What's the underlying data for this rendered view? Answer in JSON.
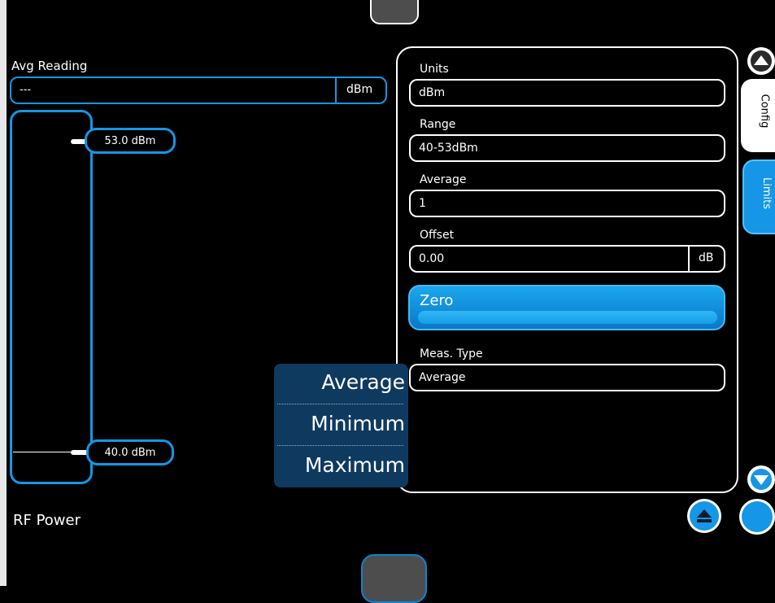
{
  "avg_reading": {
    "label": "Avg Reading",
    "value": "---",
    "unit": "dBm"
  },
  "gauge": {
    "upper_limit": "53.0 dBm",
    "lower_limit": "40.0 dBm"
  },
  "rf_label": "RF Power",
  "config": {
    "units": {
      "label": "Units",
      "value": "dBm"
    },
    "range": {
      "label": "Range",
      "value": "40-53dBm"
    },
    "average": {
      "label": "Average",
      "value": "1"
    },
    "offset": {
      "label": "Offset",
      "value": "0.00",
      "unit": "dB"
    },
    "zero_button": "Zero",
    "meas_type": {
      "label": "Meas. Type",
      "value": "Average"
    }
  },
  "meas_type_options": [
    "Average",
    "Minimum",
    "Maximum"
  ],
  "side_tabs": {
    "config": "Config",
    "limits": "Limits"
  },
  "colors": {
    "accent": "#1596e6",
    "background": "#000000"
  }
}
